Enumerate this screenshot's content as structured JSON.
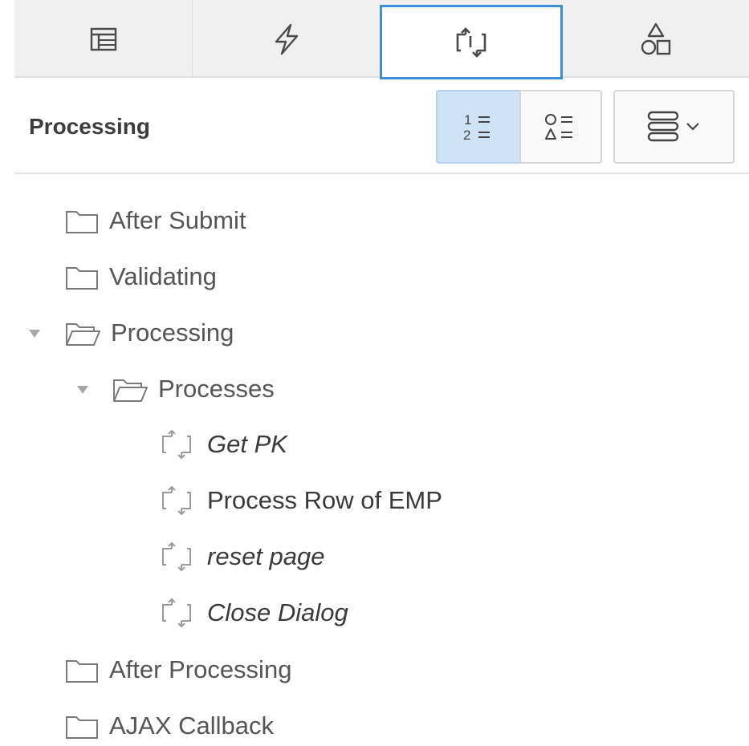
{
  "tabs": [
    {
      "icon": "rendering-tree-icon",
      "active": false
    },
    {
      "icon": "lightning-bolt-icon",
      "active": false
    },
    {
      "icon": "processing-arrows-icon",
      "active": true
    },
    {
      "icon": "shapes-icon",
      "active": false
    }
  ],
  "panel": {
    "title": "Processing",
    "view_buttons": [
      {
        "icon": "ordered-list-icon",
        "selected": true
      },
      {
        "icon": "component-type-list-icon",
        "selected": false
      },
      {
        "icon": "stacked-menu-icon",
        "selected": false
      }
    ]
  },
  "tree": [
    {
      "label": "After Submit",
      "type": "folder",
      "expanded": false,
      "italic": false
    },
    {
      "label": "Validating",
      "type": "folder",
      "expanded": false,
      "italic": false
    },
    {
      "label": "Processing",
      "type": "folder",
      "expanded": true,
      "italic": false
    },
    {
      "label": "Processes",
      "type": "folder",
      "expanded": true,
      "italic": false
    },
    {
      "label": "Get PK",
      "type": "process",
      "italic": true
    },
    {
      "label": "Process Row of EMP",
      "type": "process",
      "italic": false
    },
    {
      "label": "reset page",
      "type": "process",
      "italic": true
    },
    {
      "label": "Close Dialog",
      "type": "process",
      "italic": true
    },
    {
      "label": "After Processing",
      "type": "folder",
      "expanded": false,
      "italic": false
    },
    {
      "label": "AJAX Callback",
      "type": "folder",
      "expanded": false,
      "italic": false
    }
  ]
}
